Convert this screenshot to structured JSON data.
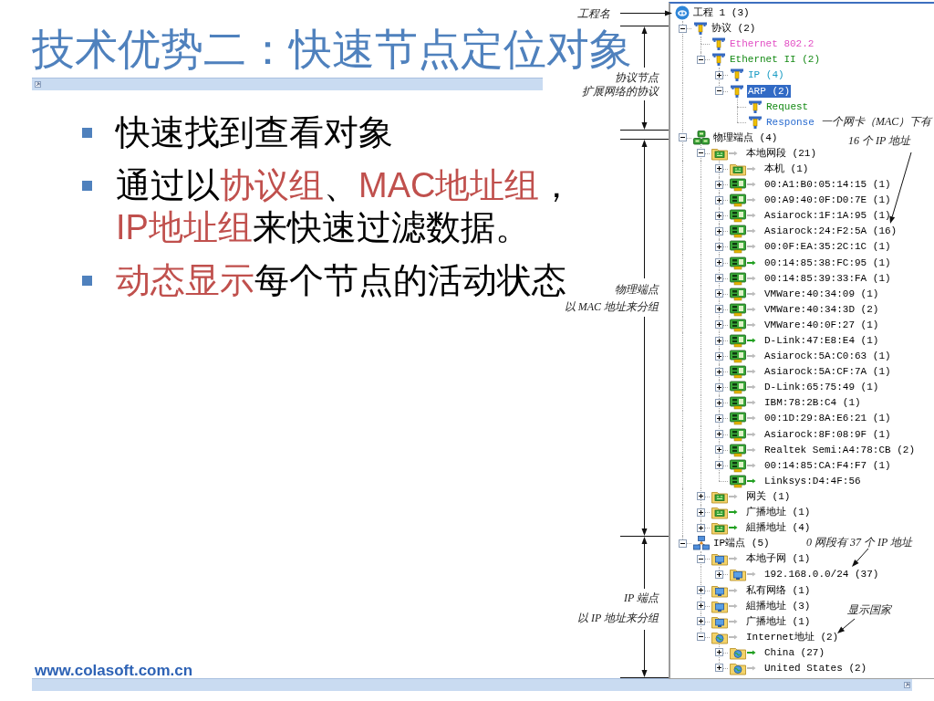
{
  "slide": {
    "title": "技术优势二：快速节点定位对象",
    "bullets": [
      {
        "segments": [
          {
            "text": "快速找到查看对象",
            "highlight": false
          }
        ]
      },
      {
        "segments": [
          {
            "text": "通过以",
            "highlight": false
          },
          {
            "text": "协议组",
            "highlight": true
          },
          {
            "text": "、",
            "highlight": false
          },
          {
            "text": "MAC地址组",
            "highlight": true
          },
          {
            "text": "，",
            "highlight": false
          },
          {
            "text": "IP地址组",
            "highlight": true
          },
          {
            "text": "来快速过滤数据。",
            "highlight": false
          }
        ]
      },
      {
        "segments": [
          {
            "text": "动态显示",
            "highlight": true
          },
          {
            "text": "每个节点的活动状态",
            "highlight": false
          }
        ]
      }
    ],
    "website": "www.colasoft.com.cn"
  },
  "annotations": {
    "project_label": "工程名",
    "sections": [
      {
        "title": "协议节点",
        "note": "扩展网络的协议"
      },
      {
        "title": "物理端点",
        "note": "以 MAC 地址来分组"
      },
      {
        "title": "IP 端点",
        "note": "以 IP 地址来分组"
      }
    ],
    "callouts": [
      {
        "lines": [
          "一个网卡（MAC）下有",
          "16 个 IP 地址"
        ]
      },
      {
        "lines": [
          "0 网段有 37 个 IP 地址"
        ]
      },
      {
        "lines": [
          "显示国家"
        ]
      }
    ]
  },
  "tree": [
    {
      "label": "工程 1 (3)",
      "kind": "project",
      "selected": false,
      "children": [
        {
          "label": "协议 (2)",
          "kind": "protocol",
          "selected": false,
          "expanded": true,
          "children": [
            {
              "label": "Ethernet 802.2",
              "kind": "protocol",
              "selected": false,
              "color": "#e24ec4"
            },
            {
              "label": "Ethernet II (2)",
              "kind": "protocol",
              "selected": false,
              "expanded": true,
              "color": "#158a15",
              "children": [
                {
                  "label": "IP (4)",
                  "kind": "protocol",
                  "selected": false,
                  "expanded": false,
                  "color": "#1a9cc4"
                },
                {
                  "label": "ARP (2)",
                  "kind": "protocol",
                  "selected": true,
                  "expanded": true,
                  "children": [
                    {
                      "label": "Request",
                      "kind": "protocol",
                      "selected": false,
                      "color": "#158a15"
                    },
                    {
                      "label": "Response",
                      "kind": "protocol",
                      "selected": false,
                      "color": "#2a6cd0"
                    }
                  ]
                }
              ]
            }
          ]
        },
        {
          "label": "物理端点 (4)",
          "kind": "hosts",
          "selected": false,
          "expanded": true,
          "children": [
            {
              "label": "本地网段 (21)",
              "kind": "folder",
              "selected": false,
              "expanded": true,
              "active": false,
              "children": [
                {
                  "label": "本机 (1)",
                  "kind": "folder",
                  "selected": false,
                  "expanded": false,
                  "active": false
                },
                {
                  "label": "00:A1:B0:05:14:15 (1)",
                  "kind": "card",
                  "selected": false,
                  "expanded": false,
                  "active": false
                },
                {
                  "label": "00:A9:40:0F:D0:7E (1)",
                  "kind": "card",
                  "selected": false,
                  "expanded": false,
                  "active": false
                },
                {
                  "label": "Asiarock:1F:1A:95 (1)",
                  "kind": "card",
                  "selected": false,
                  "expanded": false,
                  "active": false
                },
                {
                  "label": "Asiarock:24:F2:5A (16)",
                  "kind": "card",
                  "selected": false,
                  "expanded": false,
                  "active": false
                },
                {
                  "label": "00:0F:EA:35:2C:1C (1)",
                  "kind": "card",
                  "selected": false,
                  "expanded": false,
                  "active": false
                },
                {
                  "label": "00:14:85:38:FC:95 (1)",
                  "kind": "card",
                  "selected": false,
                  "expanded": false,
                  "active": true
                },
                {
                  "label": "00:14:85:39:33:FA (1)",
                  "kind": "card",
                  "selected": false,
                  "expanded": false,
                  "active": false
                },
                {
                  "label": "VMWare:40:34:09 (1)",
                  "kind": "card",
                  "selected": false,
                  "expanded": false,
                  "active": false
                },
                {
                  "label": "VMWare:40:34:3D (2)",
                  "kind": "card",
                  "selected": false,
                  "expanded": false,
                  "active": false
                },
                {
                  "label": "VMWare:40:0F:27 (1)",
                  "kind": "card",
                  "selected": false,
                  "expanded": false,
                  "active": false
                },
                {
                  "label": "D-Link:47:E8:E4 (1)",
                  "kind": "card",
                  "selected": false,
                  "expanded": false,
                  "active": true
                },
                {
                  "label": "Asiarock:5A:C0:63 (1)",
                  "kind": "card",
                  "selected": false,
                  "expanded": false,
                  "active": false
                },
                {
                  "label": "Asiarock:5A:CF:7A (1)",
                  "kind": "card",
                  "selected": false,
                  "expanded": false,
                  "active": false
                },
                {
                  "label": "D-Link:65:75:49 (1)",
                  "kind": "card",
                  "selected": false,
                  "expanded": false,
                  "active": false
                },
                {
                  "label": "IBM:78:2B:C4 (1)",
                  "kind": "card",
                  "selected": false,
                  "expanded": false,
                  "active": false
                },
                {
                  "label": "00:1D:29:8A:E6:21 (1)",
                  "kind": "card",
                  "selected": false,
                  "expanded": false,
                  "active": false
                },
                {
                  "label": "Asiarock:8F:08:9F (1)",
                  "kind": "card",
                  "selected": false,
                  "expanded": false,
                  "active": false
                },
                {
                  "label": "Realtek Semi:A4:78:CB (2)",
                  "kind": "card",
                  "selected": false,
                  "expanded": false,
                  "active": false
                },
                {
                  "label": "00:14:85:CA:F4:F7 (1)",
                  "kind": "card",
                  "selected": false,
                  "expanded": false,
                  "active": false
                },
                {
                  "label": "Linksys:D4:4F:56",
                  "kind": "card",
                  "selected": false,
                  "active": true
                }
              ]
            },
            {
              "label": "网关 (1)",
              "kind": "folder",
              "selected": false,
              "expanded": false,
              "active": false
            },
            {
              "label": "广播地址 (1)",
              "kind": "folder",
              "selected": false,
              "expanded": false,
              "active": true
            },
            {
              "label": "組播地址 (4)",
              "kind": "folder",
              "selected": false,
              "expanded": false,
              "active": true
            }
          ]
        },
        {
          "label": "IP端点 (5)",
          "kind": "network",
          "selected": false,
          "expanded": true,
          "children": [
            {
              "label": "本地子网 (1)",
              "kind": "subnet",
              "selected": false,
              "expanded": true,
              "active": false,
              "children": [
                {
                  "label": "192.168.0.0/24 (37)",
                  "kind": "subnet",
                  "selected": false,
                  "expanded": false,
                  "active": false
                }
              ]
            },
            {
              "label": "私有网络 (1)",
              "kind": "subnet",
              "selected": false,
              "expanded": false,
              "active": false
            },
            {
              "label": "組播地址 (3)",
              "kind": "subnet",
              "selected": false,
              "expanded": false,
              "active": false
            },
            {
              "label": "广播地址 (1)",
              "kind": "subnet",
              "selected": false,
              "expanded": false,
              "active": false
            },
            {
              "label": "Internet地址 (2)",
              "kind": "region",
              "selected": false,
              "expanded": true,
              "active": false,
              "children": [
                {
                  "label": "China (27)",
                  "kind": "region",
                  "selected": false,
                  "expanded": false,
                  "active": true
                },
                {
                  "label": "United States (2)",
                  "kind": "region",
                  "selected": false,
                  "expanded": false,
                  "active": false
                }
              ]
            }
          ]
        }
      ]
    }
  ]
}
